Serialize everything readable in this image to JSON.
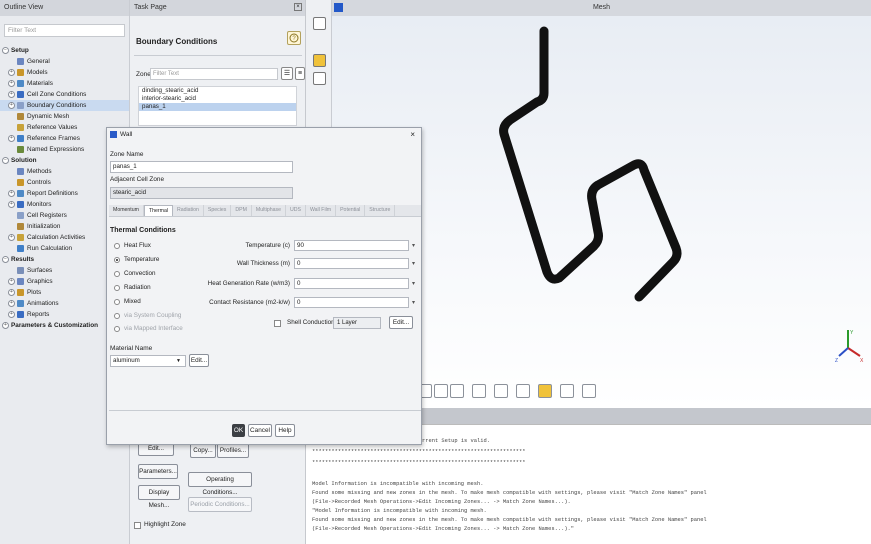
{
  "outline": {
    "title": "Outline View",
    "filter_placeholder": "Filter Text",
    "tree": [
      {
        "label": "Setup",
        "bold": true,
        "exp": "−"
      },
      {
        "label": "General",
        "exp": ""
      },
      {
        "label": "Models",
        "exp": "+"
      },
      {
        "label": "Materials",
        "exp": "+"
      },
      {
        "label": "Cell Zone Conditions",
        "exp": "+"
      },
      {
        "label": "Boundary Conditions",
        "exp": "+",
        "selected": true
      },
      {
        "label": "Dynamic Mesh",
        "exp": ""
      },
      {
        "label": "Reference Values",
        "exp": ""
      },
      {
        "label": "Reference Frames",
        "exp": "+"
      },
      {
        "label": "Named Expressions",
        "exp": ""
      },
      {
        "label": "Solution",
        "bold": true,
        "exp": "−"
      },
      {
        "label": "Methods",
        "exp": ""
      },
      {
        "label": "Controls",
        "exp": ""
      },
      {
        "label": "Report Definitions",
        "exp": "+"
      },
      {
        "label": "Monitors",
        "exp": "+"
      },
      {
        "label": "Cell Registers",
        "exp": ""
      },
      {
        "label": "Initialization",
        "exp": ""
      },
      {
        "label": "Calculation Activities",
        "exp": "+"
      },
      {
        "label": "Run Calculation",
        "exp": ""
      },
      {
        "label": "Results",
        "bold": true,
        "exp": "−"
      },
      {
        "label": "Surfaces",
        "exp": ""
      },
      {
        "label": "Graphics",
        "exp": "+"
      },
      {
        "label": "Plots",
        "exp": "+"
      },
      {
        "label": "Animations",
        "exp": "+"
      },
      {
        "label": "Reports",
        "exp": "+"
      },
      {
        "label": "Parameters & Customization",
        "bold": true,
        "exp": "+"
      }
    ]
  },
  "task": {
    "title": "Task Page",
    "heading": "Boundary Conditions",
    "zone_label": "Zone",
    "zone_filter_placeholder": "Filter Text",
    "zones": [
      "dinding_stearic_acid",
      "interior-stearic_acid",
      "panas_1"
    ],
    "buttons": {
      "edit": "Edit...",
      "copy": "Copy...",
      "profiles": "Profiles...",
      "parameters": "Parameters...",
      "operating": "Operating Conditions...",
      "display_mesh": "Display Mesh...",
      "periodic": "Periodic Conditions..."
    },
    "highlight_zone": "Highlight Zone"
  },
  "graphics": {
    "title": "Mesh",
    "tube_color": "#111111"
  },
  "console": {
    "lines": [
      "rrent Setup is valid.",
      "******************************************************************",
      "******************************************************************",
      "",
      "Model Information is incompatible with incoming mesh.",
      "Found some missing and new zones in the mesh. To make mesh compatible with settings, please visit \"Match Zone Names\" panel",
      "(File->Recorded Mesh Operations->Edit Incoming Zones... -> Match Zone Names...).",
      "\"Model Information is incompatible with incoming mesh.",
      "Found some missing and new zones in the mesh. To make mesh compatible with settings, please visit \"Match Zone Names\" panel",
      "(File->Recorded Mesh Operations->Edit Incoming Zones... -> Match Zone Names...).\""
    ]
  },
  "dialog": {
    "title": "Wall",
    "zone_name_label": "Zone Name",
    "zone_name": "panas_1",
    "adjacent_label": "Adjacent Cell Zone",
    "adjacent": "stearic_acid",
    "tabs": [
      "Momentum",
      "Thermal",
      "Radiation",
      "Species",
      "DPM",
      "Multiphase",
      "UDS",
      "Wall Film",
      "Potential",
      "Structure"
    ],
    "active_tab": "Thermal",
    "thermal_title": "Thermal Conditions",
    "options": [
      "Heat Flux",
      "Temperature",
      "Convection",
      "Radiation",
      "Mixed",
      "via System Coupling",
      "via Mapped Interface"
    ],
    "selected_option": "Temperature",
    "fields": [
      {
        "label": "Temperature (c)",
        "value": "90"
      },
      {
        "label": "Wall Thickness (m)",
        "value": "0"
      },
      {
        "label": "Heat Generation Rate (w/m3)",
        "value": "0"
      },
      {
        "label": "Contact Resistance (m2-k/w)",
        "value": "0"
      }
    ],
    "shell_conduction": "Shell Conduction",
    "layers": "1 Layer",
    "edit": "Edit...",
    "material_label": "Material Name",
    "material": "aluminum",
    "material_edit": "Edit...",
    "ok": "OK",
    "cancel": "Cancel",
    "help": "Help"
  },
  "triad": {
    "x": "X",
    "y": "Y",
    "z": "Z"
  }
}
